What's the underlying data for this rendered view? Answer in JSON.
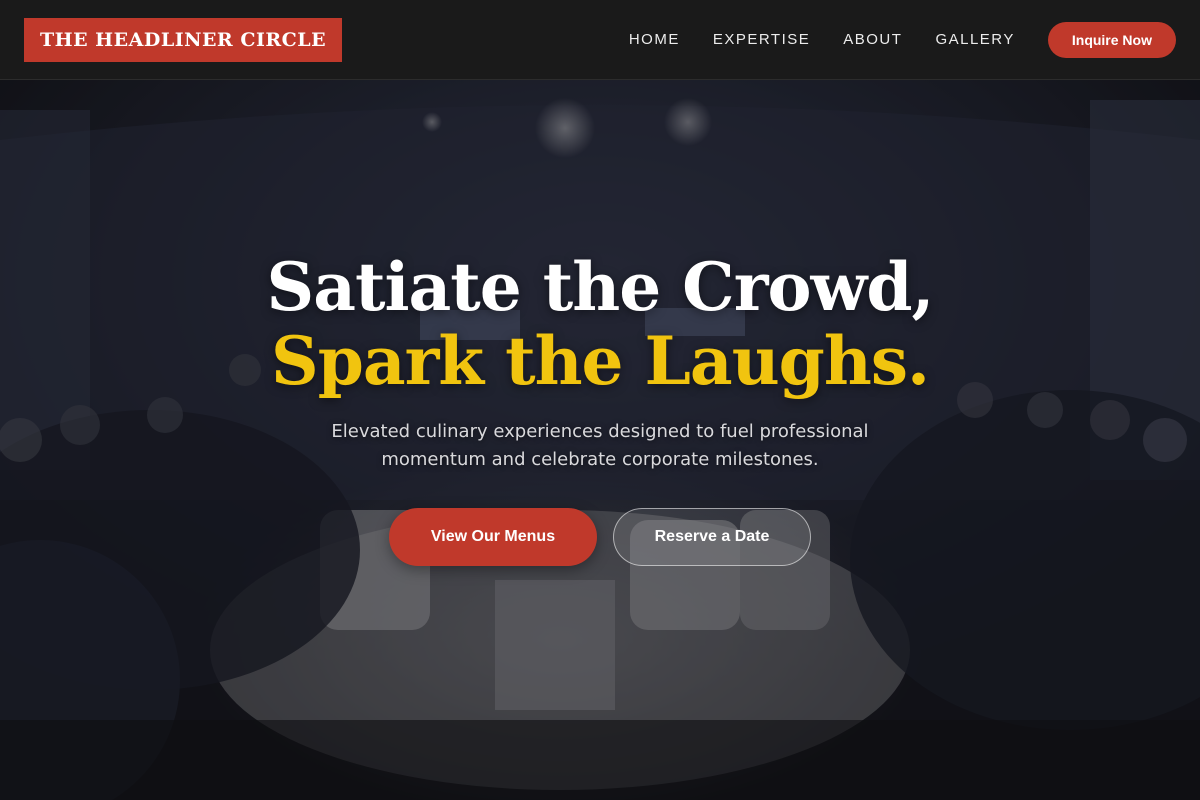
{
  "brand": {
    "logo_text": "THE HEADLINER CIRCLE",
    "accent_color": "#c0392b",
    "highlight_color": "#f1c40f"
  },
  "nav": {
    "links": [
      {
        "label": "HOME"
      },
      {
        "label": "EXPERTISE"
      },
      {
        "label": "ABOUT"
      },
      {
        "label": "GALLERY"
      }
    ],
    "cta_label": "Inquire Now"
  },
  "hero": {
    "title_line1": "Satiate the Crowd,",
    "title_line2": "Spark the Laughs.",
    "subtitle": "Elevated culinary experiences designed to fuel professional momentum and celebrate corporate milestones.",
    "primary_button": "View Our Menus",
    "secondary_button": "Reserve a Date",
    "background_image": "panel-discussion-audience-photo"
  }
}
